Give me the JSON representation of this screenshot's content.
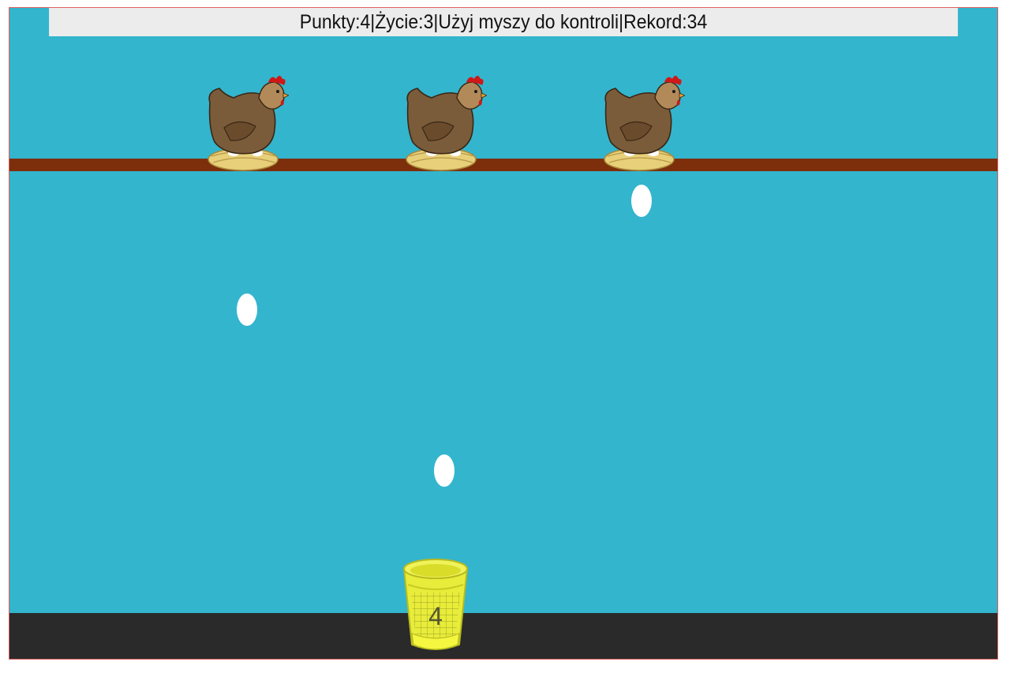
{
  "hud": {
    "points_label": "Punkty:",
    "points": "4",
    "lives_label": "Życie:",
    "lives": "3",
    "hint": "Użyj myszy do kontroli",
    "record_label": "Rekord:",
    "record": "34",
    "separator": "|"
  },
  "scene": {
    "hen_count": 3,
    "falling_eggs": 3
  },
  "basket": {
    "count": "4"
  },
  "colors": {
    "sky": "#33b5cd",
    "perch": "#7d2e0b",
    "ground": "#2a2a2a",
    "basket": "#e8ec3a",
    "egg": "#ffffff",
    "hen": "#7b5c3a"
  }
}
